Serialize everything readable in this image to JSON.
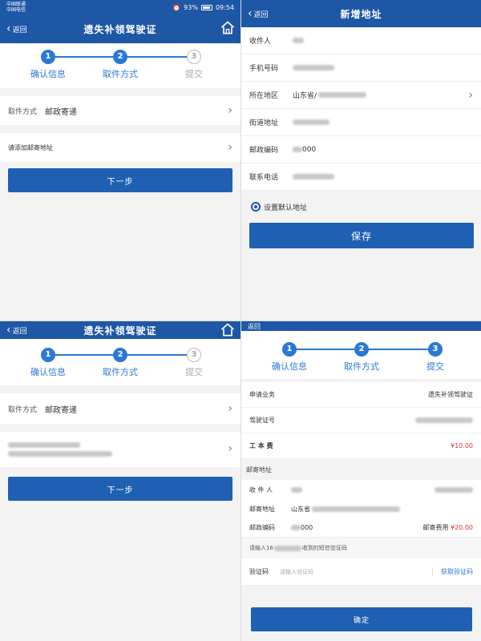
{
  "status": {
    "carrier1": "中国联通",
    "carrier2": "中国电信",
    "battery": "93%",
    "time": "09:54"
  },
  "nav": {
    "back_label": "返回"
  },
  "titles": {
    "replacement": "遗失补领驾驶证",
    "new_address": "新增地址"
  },
  "steps": {
    "s1_num": "1",
    "s1_label": "确认信息",
    "s2_num": "2",
    "s2_label": "取件方式",
    "s3_num": "3",
    "s3_label": "提交"
  },
  "pickup": {
    "method_key": "取件方式",
    "method_value": "邮政寄递",
    "add_address": "请添加邮寄地址",
    "next_button": "下一步"
  },
  "address_form": {
    "recipient": "收件人",
    "phone": "手机号码",
    "region": "所在地区",
    "region_value": "山东省/",
    "street": "街道地址",
    "postcode": "邮政编码",
    "postcode_value": "000",
    "contact_phone": "联系电话",
    "default_label": "设置默认地址",
    "save_button": "保存"
  },
  "submit": {
    "business_key": "申请业务",
    "business_value": "遗失补领驾驶证",
    "license_key": "驾驶证号",
    "fee_key": "工 本 费",
    "fee_value": "¥10.00",
    "mail_section": "邮寄地址",
    "recipient_key": "收 件 人",
    "address_key": "邮寄地址",
    "address_value": "山东省",
    "postcode_key": "邮政编码",
    "postcode_value": "000",
    "postage_key": "邮寄费用",
    "postage_value": "¥20.00",
    "sms_hint_prefix": "请输入16",
    "sms_hint_suffix": "收到的短信验证码",
    "code_key": "验证码",
    "code_placeholder": "请输入验证码",
    "get_code": "获取验证码",
    "confirm_button": "确定"
  }
}
